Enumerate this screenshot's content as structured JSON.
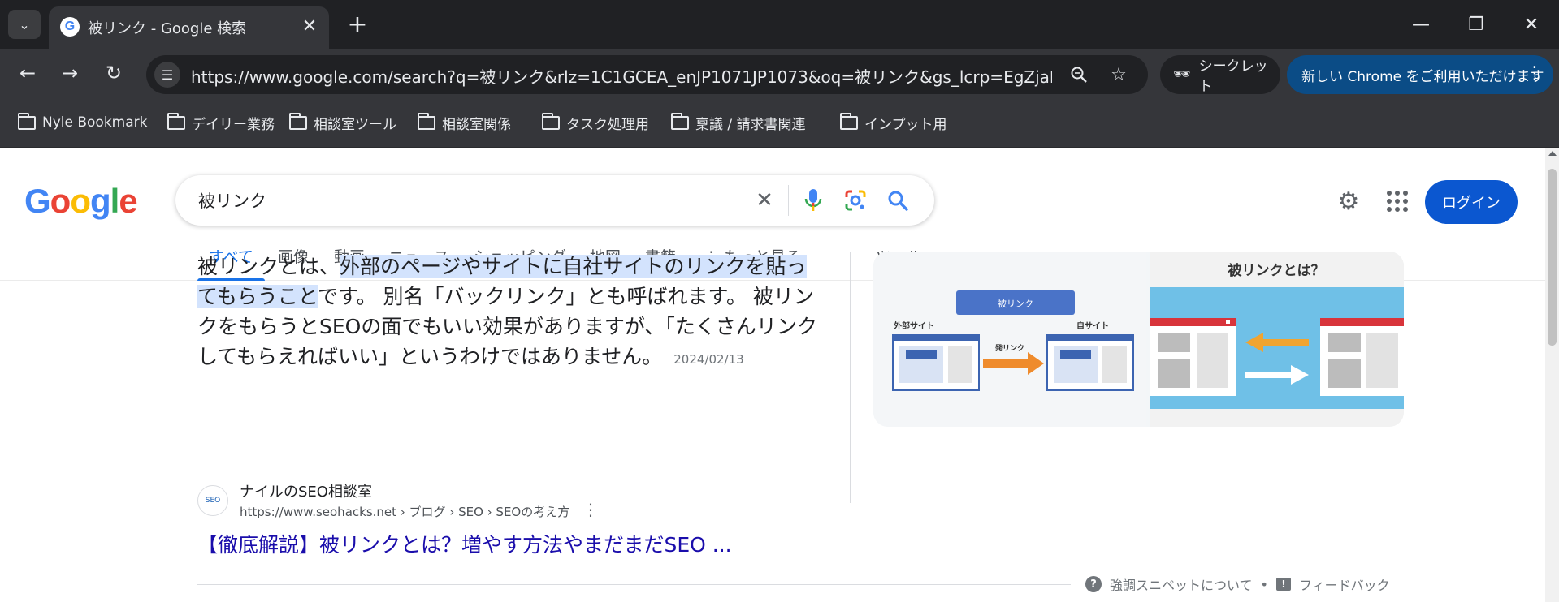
{
  "browser": {
    "tab_title": "被リンク - Google 検索",
    "favicon_letter": "G",
    "url": "https://www.google.com/search?q=被リンク&rlz=1C1GCEA_enJP1071JP1073&oq=被リンク&gs_lcrp=EgZjaHJvbWU...",
    "incognito_label": "シークレット",
    "update_label": "新しい Chrome をご利用いただけます"
  },
  "bookmarks": [
    {
      "label": "Nyle Bookmark"
    },
    {
      "label": "デイリー業務"
    },
    {
      "label": "相談室ツール"
    },
    {
      "label": "相談室関係"
    },
    {
      "label": "タスク処理用"
    },
    {
      "label": "稟議 / 請求書関連"
    },
    {
      "label": "インプット用"
    }
  ],
  "google": {
    "logo_letters": [
      "G",
      "o",
      "o",
      "g",
      "l",
      "e"
    ],
    "query": "被リンク",
    "login_label": "ログイン",
    "tabs": [
      {
        "label": "すべて",
        "active": true
      },
      {
        "label": "画像"
      },
      {
        "label": "動画"
      },
      {
        "label": "ニュース"
      },
      {
        "label": "ショッピング"
      },
      {
        "label": "地図"
      },
      {
        "label": "書籍"
      },
      {
        "label": "もっと見る"
      },
      {
        "label": "ツール"
      }
    ]
  },
  "snippet": {
    "prefix": "被リンクとは、",
    "highlight1": "外部のページやサイトに自社サイトのリンクを",
    "highlight2": "貼ってもらうこと",
    "rest": "です。 別名「バックリンク」とも呼ばれます。 被リンクをもらうとSEOの面でもいい効果がありますが、「たくさんリンクしてもらえればいい」というわけではありません。",
    "date": "2024/02/13"
  },
  "image": {
    "badge": "被リンク",
    "external_site": "外部サイト",
    "own_site": "自サイト",
    "link_label": "発リンク",
    "right_title": "被リンクとは？"
  },
  "source": {
    "name": "ナイルのSEO相談室",
    "url": "https://www.seohacks.net › ブログ › SEO › SEOの考え方",
    "title": "【徹底解説】被リンクとは？増やす方法やまだまだSEO ..."
  },
  "footer": {
    "about_label": "強調スニペットについて",
    "separator": "•",
    "feedback_label": "フィードバック"
  },
  "colors": {
    "google_blue": "#4285f4",
    "link_blue": "#1a0dab",
    "active_tab": "#1a73e8",
    "login_bg": "#0b57d0",
    "highlight": "#d3e3fd"
  }
}
